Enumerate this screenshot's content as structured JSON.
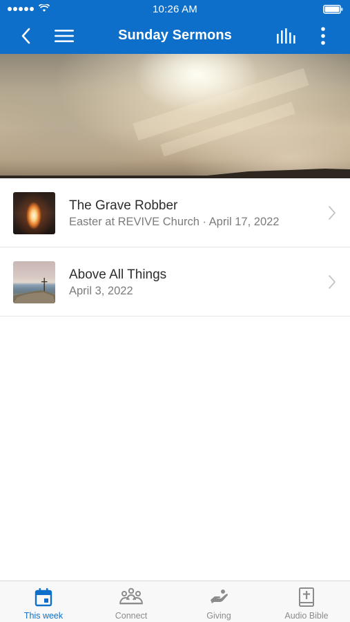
{
  "status_bar": {
    "time": "10:26 AM"
  },
  "nav": {
    "title": "Sunday Sermons"
  },
  "sermons": [
    {
      "title": "The Grave Robber",
      "subtitle": "Easter at REVIVE Church · April 17, 2022",
      "thumb": "tomb-light-image"
    },
    {
      "title": "Above All Things",
      "subtitle": "April 3, 2022",
      "thumb": "mountain-cross-image"
    }
  ],
  "tabs": [
    {
      "label": "This week",
      "icon": "calendar-icon",
      "active": true
    },
    {
      "label": "Connect",
      "icon": "people-icon",
      "active": false
    },
    {
      "label": "Giving",
      "icon": "hand-giving-icon",
      "active": false
    },
    {
      "label": "Audio Bible",
      "icon": "bible-icon",
      "active": false
    }
  ],
  "colors": {
    "accent": "#0d6fc9",
    "inactive": "#8b8b8b",
    "divider": "#e3e3e3"
  }
}
